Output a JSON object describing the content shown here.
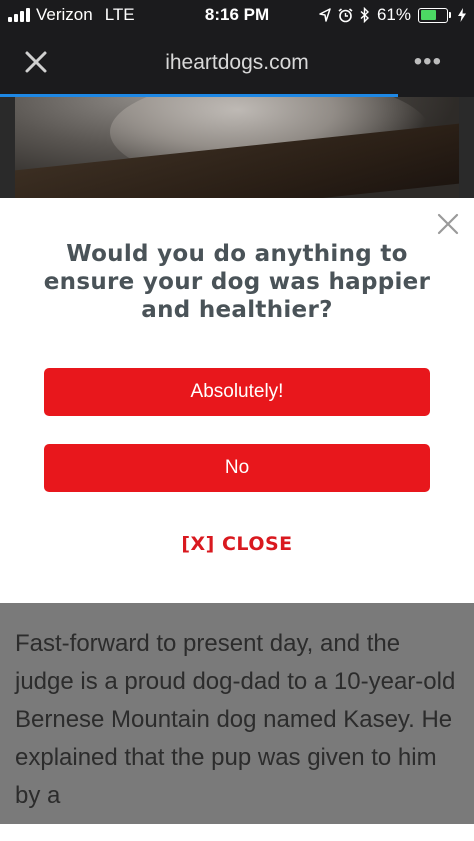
{
  "status_bar": {
    "carrier": "Verizon",
    "network": "LTE",
    "time": "8:16 PM",
    "battery_percent": "61%",
    "battery_level": 0.61,
    "battery_color": "#4cd964"
  },
  "nav_bar": {
    "domain": "iheartdogs.com",
    "close_icon": "close-icon",
    "more_icon": "more-icon",
    "more_label": "•••"
  },
  "modal": {
    "question": "Would you do anything to ensure your dog was happier and healthier?",
    "yes_label": "Absolutely!",
    "no_label": "No",
    "close_label": "[X] CLOSE",
    "accent": "#e8171c"
  },
  "article": {
    "text": "Fast-forward to present day, and the judge is a proud dog-dad to a 10-year-old Bernese Mountain dog named Kasey. He explained that the pup was given to him by a"
  }
}
